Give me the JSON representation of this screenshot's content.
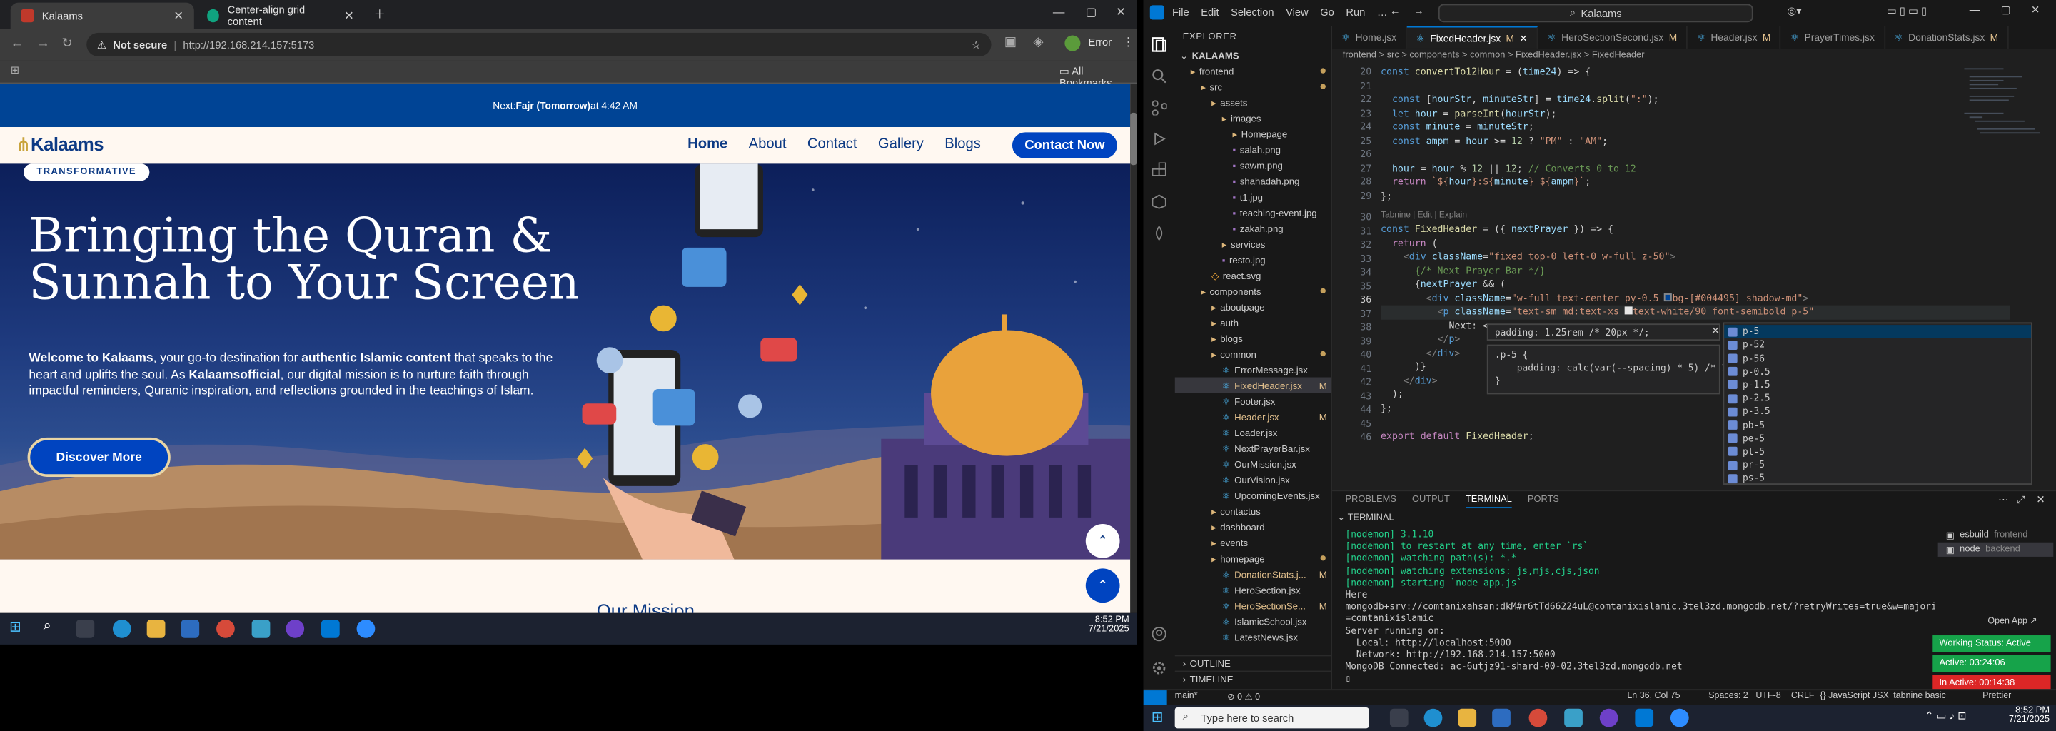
{
  "chrome": {
    "tabs": [
      {
        "title": "Kalaams",
        "active": true
      },
      {
        "title": "Center-align grid content",
        "active": false
      }
    ],
    "not_secure": "Not secure",
    "url": "http://192.168.214.157:5173",
    "error_label": "Error",
    "all_bookmarks": "All Bookmarks"
  },
  "site": {
    "prayer_prefix": "Next: ",
    "prayer_name": "Fajr (Tomorrow)",
    "prayer_time": " at 4:42 AM",
    "logo": "Kalaams",
    "nav": [
      "Home",
      "About",
      "Contact",
      "Gallery",
      "Blogs"
    ],
    "contact_button": "Contact Now",
    "badge": "TRANSFORMATIVE",
    "headline": "Bringing the Quran & Sunnah to Your Screen",
    "para_1": "Welcome to Kalaams",
    "para_2": ", your go-to destination for ",
    "para_3": "authentic Islamic content",
    "para_4": " that speaks to the heart and uplifts the soul. As ",
    "para_5": "Kalaamsofficial",
    "para_6": ", our digital mission is to nurture faith through impactful reminders, Quranic inspiration, and reflections grounded in the teachings of Islam.",
    "discover_button": "Discover More",
    "section_heading": "Our Mission"
  },
  "left_taskbar": {
    "time": "8:52 PM",
    "date": "7/21/2025"
  },
  "vscode": {
    "menu": [
      "File",
      "Edit",
      "Selection",
      "View",
      "Go",
      "Run",
      "…"
    ],
    "command_center": "Kalaams",
    "explorer_title": "EXPLORER",
    "tree": [
      {
        "label": "KALAAMS",
        "depth": 0,
        "kind": "root"
      },
      {
        "label": "frontend",
        "depth": 1,
        "kind": "folder",
        "dot": true
      },
      {
        "label": "src",
        "depth": 2,
        "kind": "folder",
        "dot": true
      },
      {
        "label": "assets",
        "depth": 3,
        "kind": "folder"
      },
      {
        "label": "images",
        "depth": 4,
        "kind": "folder"
      },
      {
        "label": "Homepage",
        "depth": 5,
        "kind": "folder"
      },
      {
        "label": "salah.png",
        "depth": 5,
        "kind": "img"
      },
      {
        "label": "sawm.png",
        "depth": 5,
        "kind": "img"
      },
      {
        "label": "shahadah.png",
        "depth": 5,
        "kind": "img"
      },
      {
        "label": "t1.jpg",
        "depth": 5,
        "kind": "img"
      },
      {
        "label": "teaching-event.jpg",
        "depth": 5,
        "kind": "img"
      },
      {
        "label": "zakah.png",
        "depth": 5,
        "kind": "img"
      },
      {
        "label": "services",
        "depth": 4,
        "kind": "folder"
      },
      {
        "label": "resto.jpg",
        "depth": 4,
        "kind": "img"
      },
      {
        "label": "react.svg",
        "depth": 3,
        "kind": "svg"
      },
      {
        "label": "components",
        "depth": 2,
        "kind": "folder",
        "dot": true
      },
      {
        "label": "aboutpage",
        "depth": 3,
        "kind": "folder"
      },
      {
        "label": "auth",
        "depth": 3,
        "kind": "folder"
      },
      {
        "label": "blogs",
        "depth": 3,
        "kind": "folder"
      },
      {
        "label": "common",
        "depth": 3,
        "kind": "folder",
        "dot": true
      },
      {
        "label": "ErrorMessage.jsx",
        "depth": 4,
        "kind": "jsx"
      },
      {
        "label": "FixedHeader.jsx",
        "depth": 4,
        "kind": "jsx",
        "mod": "M",
        "selected": true
      },
      {
        "label": "Footer.jsx",
        "depth": 4,
        "kind": "jsx"
      },
      {
        "label": "Header.jsx",
        "depth": 4,
        "kind": "jsx",
        "mod": "M"
      },
      {
        "label": "Loader.jsx",
        "depth": 4,
        "kind": "jsx"
      },
      {
        "label": "NextPrayerBar.jsx",
        "depth": 4,
        "kind": "jsx"
      },
      {
        "label": "OurMission.jsx",
        "depth": 4,
        "kind": "jsx"
      },
      {
        "label": "OurVision.jsx",
        "depth": 4,
        "kind": "jsx"
      },
      {
        "label": "UpcomingEvents.jsx",
        "depth": 4,
        "kind": "jsx"
      },
      {
        "label": "contactus",
        "depth": 3,
        "kind": "folder"
      },
      {
        "label": "dashboard",
        "depth": 3,
        "kind": "folder"
      },
      {
        "label": "events",
        "depth": 3,
        "kind": "folder"
      },
      {
        "label": "homepage",
        "depth": 3,
        "kind": "folder",
        "dot": true
      },
      {
        "label": "DonationStats.j...",
        "depth": 4,
        "kind": "jsx",
        "mod": "M"
      },
      {
        "label": "HeroSection.jsx",
        "depth": 4,
        "kind": "jsx"
      },
      {
        "label": "HeroSectionSe...",
        "depth": 4,
        "kind": "jsx",
        "mod": "M"
      },
      {
        "label": "IslamicSchool.jsx",
        "depth": 4,
        "kind": "jsx"
      },
      {
        "label": "LatestNews.jsx",
        "depth": 4,
        "kind": "jsx"
      }
    ],
    "outline": "OUTLINE",
    "timeline": "TIMELINE",
    "tabs": [
      {
        "label": "Home.jsx",
        "mod": ""
      },
      {
        "label": "FixedHeader.jsx",
        "mod": "M",
        "active": true
      },
      {
        "label": "HeroSectionSecond.jsx",
        "mod": "M"
      },
      {
        "label": "Header.jsx",
        "mod": "M"
      },
      {
        "label": "PrayerTimes.jsx",
        "mod": ""
      },
      {
        "label": "DonationStats.jsx",
        "mod": "M"
      }
    ],
    "breadcrumbs": "frontend > src > components > common > FixedHeader.jsx > FixedHeader",
    "line_numbers": [
      20,
      21,
      22,
      23,
      24,
      25,
      26,
      27,
      28,
      29,
      "",
      30,
      31,
      32,
      33,
      34,
      35,
      36,
      37,
      38,
      39,
      40,
      41,
      42,
      43,
      44,
      45,
      46
    ],
    "current_line": 36,
    "codelens": "Tabnine | Edit | Explain",
    "hover_line_1": "padding: 1.25rem /* 20px */;",
    "hover_line_2": ".p-5 {",
    "hover_line_3": "    padding: calc(var(--spacing) * 5) /* 1",
    "hover_line_4": "}",
    "suggestions": [
      "p-5",
      "p-52",
      "p-56",
      "p-0.5",
      "p-1.5",
      "p-2.5",
      "p-3.5",
      "pb-5",
      "pe-5",
      "pl-5",
      "pr-5",
      "ps-5"
    ],
    "panel_tabs": [
      "PROBLEMS",
      "OUTPUT",
      "TERMINAL",
      "PORTS"
    ],
    "terminal_header": "TERMINAL",
    "terminal_lines": [
      "[nodemon] 3.1.10",
      "[nodemon] to restart at any time, enter `rs`",
      "[nodemon] watching path(s): *.*",
      "[nodemon] watching extensions: js,mjs,cjs,json",
      "[nodemon] starting `node app.js`",
      "Here",
      "mongodb+srv://comtanixahsan:dkM#r6tTd66224uL@comtanixislamic.3tel3zd.mongodb.net/?retryWrites=true&w=majority&appName",
      "=comtanixislamic",
      "Server running on:",
      "  Local: http://localhost:5000",
      "  Network: http://192.168.214.157:5000",
      "MongoDB Connected: ac-6utjz91-shard-00-02.3tel3zd.mongodb.net"
    ],
    "terminals": [
      {
        "label": "esbuild",
        "sub": "frontend"
      },
      {
        "label": "node",
        "sub": "backend",
        "active": true
      }
    ],
    "open_app": "Open App ↗",
    "working_status": "Working Status: Active",
    "active_time": "Active: 03:24:06",
    "inactive_time": "In Active: 00:14:38",
    "panel_bottom_label": "TERMINAL",
    "status_left": [
      "main*",
      "⊘ 0 ⚠ 0"
    ],
    "status_right": [
      "Ln 36, Col 75",
      "Spaces: 2",
      "UTF-8",
      "CRLF",
      "{} JavaScript JSX",
      "tabnine basic",
      "Prettier"
    ]
  },
  "right_taskbar": {
    "search": "Type here to search",
    "time": "8:52 PM",
    "date": "7/21/2025"
  },
  "colors": {
    "brand_blue": "#004495",
    "nav_blue": "#0d3a84",
    "button_blue": "#0044c0",
    "vscode_accent": "#0078d4",
    "working_green": "#16a34a",
    "inactive_red": "#dc2626"
  }
}
